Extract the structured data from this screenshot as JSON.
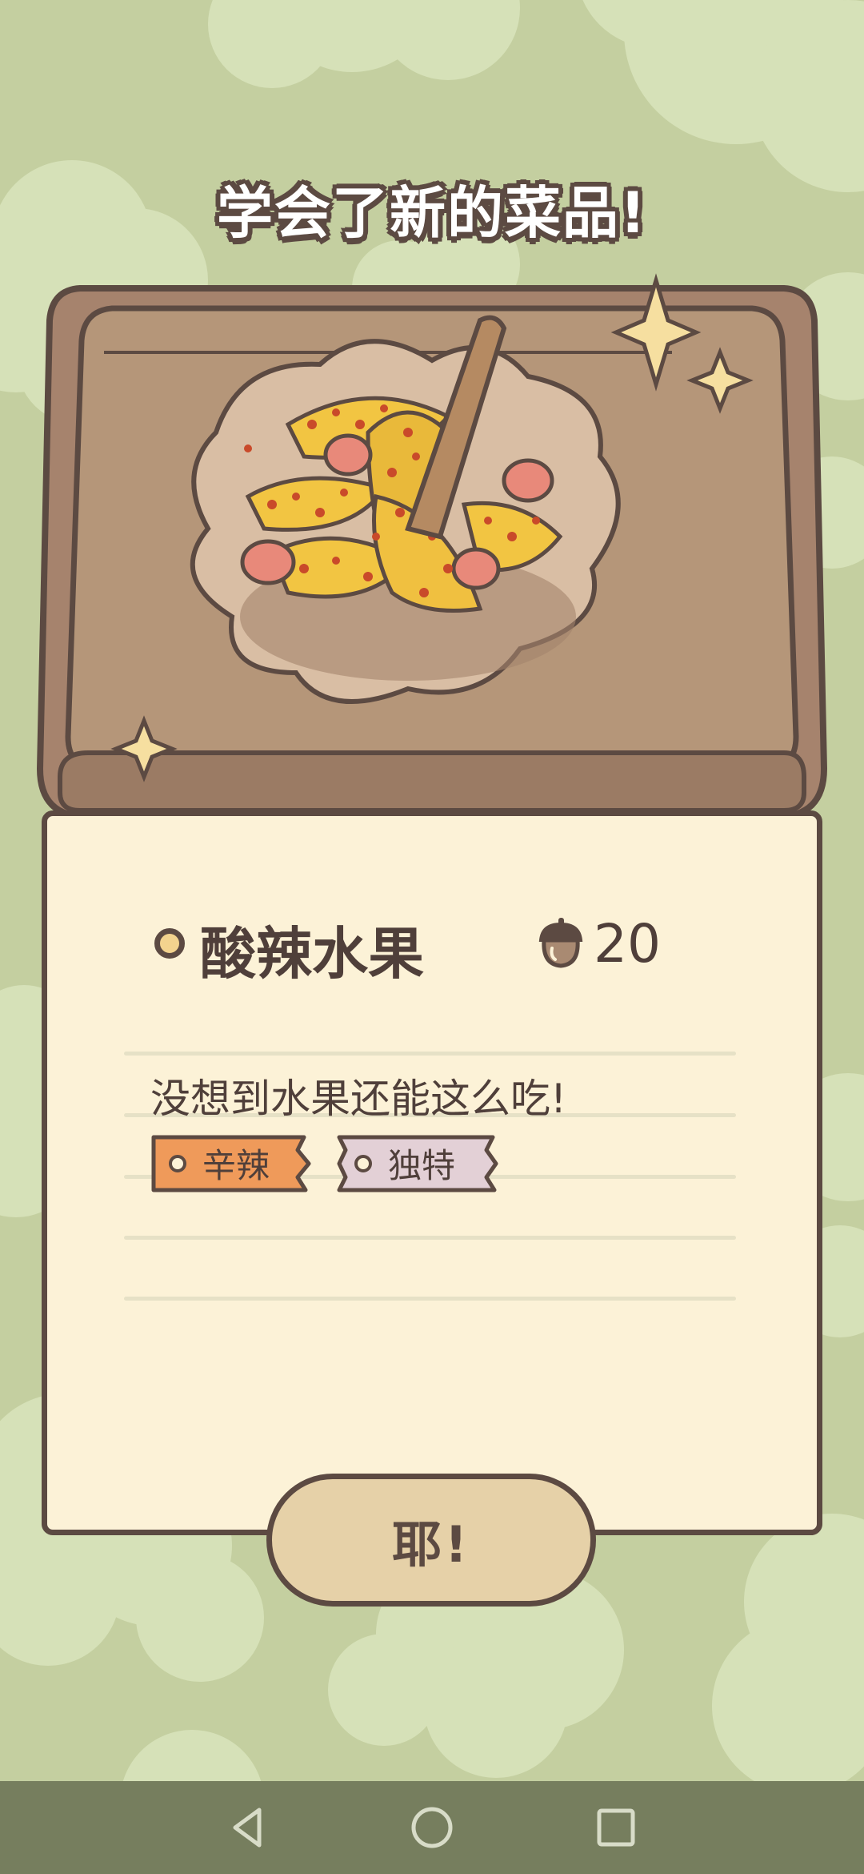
{
  "popup": {
    "title": "学会了新的菜品!",
    "dish_name": "酸辣水果",
    "price": "20",
    "description": "没想到水果还能这么吃!",
    "tags": [
      {
        "label": "辛辣",
        "color": "#ef9a5a"
      },
      {
        "label": "独特",
        "color": "#e3d0d6"
      }
    ],
    "confirm_label": "耶!"
  },
  "icons": {
    "currency": "acorn-icon",
    "bullet": "ring-bullet-icon"
  },
  "navbar": {
    "buttons": [
      "back-icon",
      "home-icon",
      "recents-icon"
    ]
  },
  "colors": {
    "background": "#c4cfa0",
    "outline": "#5c4a42",
    "card": "#fcf2d7",
    "tray": "#a68a72",
    "button": "#e6d1a8",
    "navbar": "#767e5e"
  }
}
